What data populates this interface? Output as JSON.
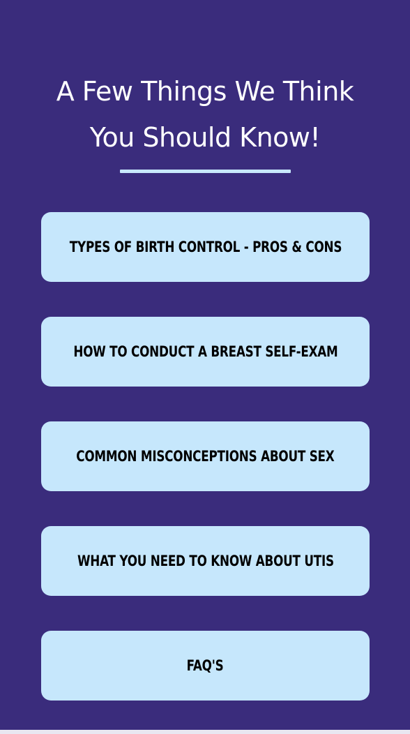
{
  "header": {
    "title_line1": "A Few Things We Think",
    "title_line2": "You Should Know!"
  },
  "menu": {
    "items": [
      {
        "label": "TYPES OF BIRTH CONTROL - PROS & CONS"
      },
      {
        "label": "HOW TO CONDUCT A BREAST SELF-EXAM"
      },
      {
        "label": "COMMON MISCONCEPTIONS ABOUT SEX"
      },
      {
        "label": "WHAT YOU NEED TO KNOW ABOUT UTIS"
      },
      {
        "label": "FAQ'S"
      }
    ]
  },
  "colors": {
    "background": "#3a2c7c",
    "button": "#c6e7fc",
    "accent_line": "#c8e8fc",
    "title_text": "#ffffff",
    "button_text": "#000000"
  }
}
